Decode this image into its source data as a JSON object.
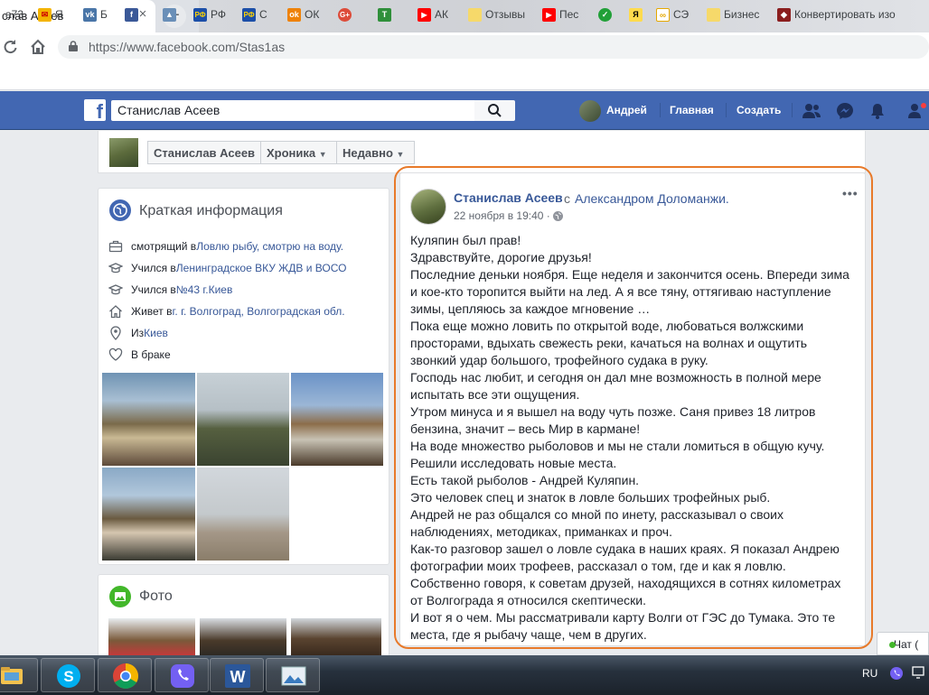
{
  "browser": {
    "tab_title": "слав Асеев",
    "tab_close": "×",
    "new_tab": "+",
    "url": "https://www.facebook.com/Stas1as",
    "bookmarks": [
      {
        "icon": "text",
        "label": "а73"
      },
      {
        "icon": "mail",
        "label": "Я"
      },
      {
        "icon": "vk",
        "label": "Б"
      },
      {
        "icon": "facebook",
        "label": ""
      },
      {
        "icon": "ship",
        "label": ""
      },
      {
        "icon": "rf",
        "label": "РФ"
      },
      {
        "icon": "rf",
        "label": "С"
      },
      {
        "icon": "ok",
        "label": "ОК"
      },
      {
        "icon": "gplus",
        "label": ""
      },
      {
        "icon": "t",
        "label": ""
      },
      {
        "icon": "youtube",
        "label": "АК"
      },
      {
        "icon": "folder",
        "label": "Отзывы"
      },
      {
        "icon": "youtube",
        "label": "Пес"
      },
      {
        "icon": "sber",
        "label": ""
      },
      {
        "icon": "yandex",
        "label": ""
      },
      {
        "icon": "link",
        "label": "СЭ"
      },
      {
        "icon": "folder",
        "label": "Бизнес"
      },
      {
        "icon": "shield",
        "label": "Конвертировать изо"
      }
    ]
  },
  "facebook": {
    "search_value": "Станислав Асеев",
    "user_name": "Андрей",
    "nav_home": "Главная",
    "nav_create": "Создать"
  },
  "profile_nav": {
    "name": "Станислав Асеев",
    "timeline": "Хроника",
    "recent": "Недавно"
  },
  "intro": {
    "title": "Краткая информация",
    "rows": [
      {
        "icon": "briefcase",
        "prefix": "смотрящий в ",
        "link": "Ловлю рыбу, смотрю на воду."
      },
      {
        "icon": "graduation-cap",
        "prefix": "Учился в ",
        "link": "Ленинградское ВКУ ЖДВ и ВОСО"
      },
      {
        "icon": "graduation-cap",
        "prefix": "Учился в ",
        "link": "№43 г.Киев"
      },
      {
        "icon": "house",
        "prefix": "Живет в ",
        "link": "г. г. Волгоград, Волгоградская обл."
      },
      {
        "icon": "map-pin",
        "prefix": "Из ",
        "link": "Киев"
      },
      {
        "icon": "heart",
        "prefix": "В браке",
        "link": ""
      }
    ]
  },
  "photos": {
    "title": "Фото"
  },
  "post": {
    "author": "Станислав Асеев",
    "with_prefix": "с",
    "with_name": "Александром Доломанжи.",
    "time": "22 ноября в 19:40 ·",
    "more": "•••",
    "lines": [
      "Куляпин был прав!",
      "Здравствуйте, дорогие друзья!",
      "Последние деньки ноября. Еще неделя и закончится осень. Впереди зима",
      "и кое-кто торопится выйти на лед. А я все тяну, оттягиваю наступление",
      "зимы, цепляюсь за каждое мгновение …",
      "Пока еще можно ловить по открытой воде, любоваться волжскими",
      "просторами, вдыхать свежесть реки, качаться на волнах и ощутить",
      "звонкий удар большого, трофейного судака в руку.",
      "Господь нас любит, и сегодня он дал мне возможность в полной мере",
      "испытать все эти ощущения.",
      "Утром минуса и я вышел на воду чуть позже. Саня привез 18 литров",
      "бензина, значит – весь Мир в кармане!",
      "На воде множество рыболовов и мы не стали ломиться в общую кучу.",
      "Решили исследовать новые места.",
      "Есть такой рыболов - Андрей Куляпин.",
      "Это человек спец и знаток в ловле больших трофейных рыб.",
      "Андрей не раз общался со мной по инету, рассказывал о своих",
      "наблюдениях, методиках, приманках и проч.",
      "Как-то разговор зашел о ловле судака в наших краях. Я показал Андрею",
      "фотографии моих трофеев, рассказал о том, где и как я ловлю.",
      "Собственно говоря, к советам друзей, находящихся в сотнях километрах",
      "от Волгограда я относился скептически.",
      "И вот я о чем. Мы рассматривали карту Волги от ГЭС до Тумака. Это те",
      "места, где я рыбачу чаще, чем в других."
    ]
  },
  "chat": {
    "label": "Чат ("
  },
  "taskbar": {
    "apps": [
      "file-explorer",
      "skype",
      "chrome",
      "viber",
      "word",
      "photo-viewer"
    ],
    "lang": "RU"
  }
}
